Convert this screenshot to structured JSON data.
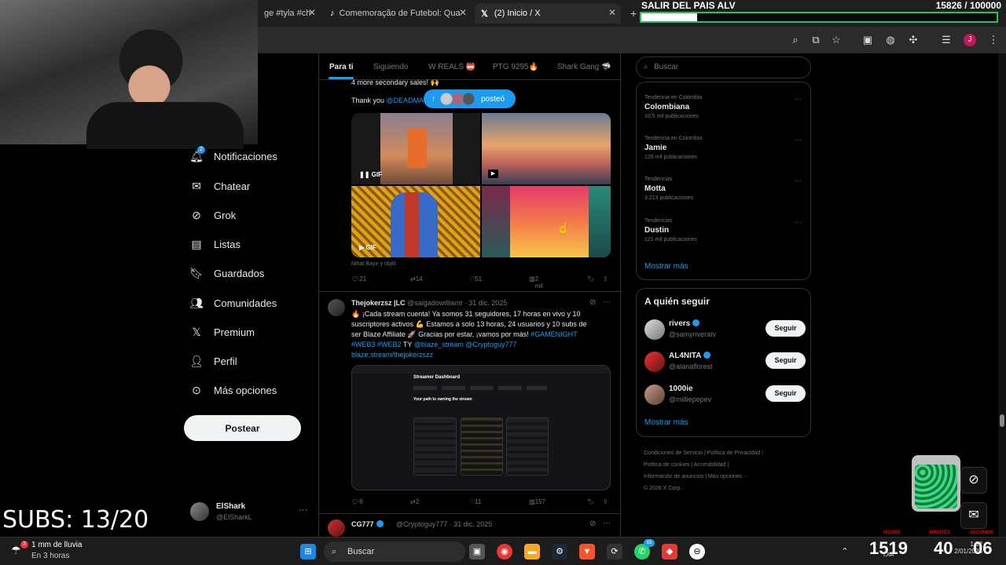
{
  "browser": {
    "tabs": [
      {
        "label": "ge #tyla #ch"
      },
      {
        "label": "Comemoração de Futebol: Qua"
      },
      {
        "label": "(2) Inicio / X"
      }
    ],
    "new_tab": "+"
  },
  "goal": {
    "title": "SALIR DEL PAIS ALV",
    "count": "15826  / 100000",
    "progress": 0.158
  },
  "nav": {
    "items": [
      {
        "label": "Notificaciones",
        "icon": "bell-icon"
      },
      {
        "label": "Chatear",
        "icon": "mail-icon"
      },
      {
        "label": "Grok",
        "icon": "grok-icon"
      },
      {
        "label": "Listas",
        "icon": "list-icon"
      },
      {
        "label": "Guardados",
        "icon": "bookmark-icon"
      },
      {
        "label": "Comunidades",
        "icon": "people-icon"
      },
      {
        "label": "Premium",
        "icon": "x-logo-icon"
      },
      {
        "label": "Perfil",
        "icon": "person-icon"
      },
      {
        "label": "Más opciones",
        "icon": "more-circle-icon"
      }
    ],
    "notif_badge": "2",
    "post_button": "Postear",
    "profile": {
      "name": "ElShark",
      "handle": "@ElSharkL",
      "more": "···"
    }
  },
  "subs_overlay": "SUBS: 13/20",
  "timeline": {
    "tabs": [
      "Para ti",
      "Siguiendo",
      "W REALS 📛",
      "PTG 9295🔥",
      "Shark Gang 🦈"
    ],
    "posted_pill": "posteó",
    "post1": {
      "text_top": "4 more secondary sales! 🙌",
      "thank_prefix": "Thank you ",
      "thank_handle": "@DEADMA",
      "gif_label": "GIF",
      "tagged": "Nihat Bayır y objkt",
      "stats": {
        "replies": "21",
        "reposts": "14",
        "likes": "51",
        "views": "2 mil"
      }
    },
    "post2": {
      "name": "Thejokerzsz |LC",
      "handle": "@salgadowilliamt",
      "date": "· 31 dic. 2025",
      "text_line1": "🔥 ¡Cada stream cuenta! Ya somos 31 seguidores, 17 horas en vivo y 10",
      "text_line2": "suscriptores activos 💪 Estamos a solo 13 horas, 24 usuarios y 10 subs de",
      "text_line3": "ser Blaze Affiliate 🚀 Gracias por estar, ¡vamos por más! ",
      "hashtag_gamenight": "#GAMENIGHT",
      "hashtags": "#WEB3 #WEB2",
      "ty": " TY ",
      "mentions": "@blaze_stream @Cryptoguy777",
      "link": "blaze.stream/thejokerzszz",
      "dashboard_title": "Streamer Dashboard",
      "dashboard_sub": "Your path to owning the stream",
      "stats": {
        "replies": "6",
        "reposts": "2",
        "likes": "11",
        "views": "157"
      }
    },
    "post3": {
      "name": "CG777",
      "handle": "@Cryptoguy777",
      "date": "· 31 dic. 2025"
    }
  },
  "right": {
    "search_placeholder": "Buscar",
    "trends": [
      {
        "context": "Tendencia en Colombia",
        "name": "Colombiana",
        "count": "10,5 mil publicaciones"
      },
      {
        "context": "Tendencia en Colombia",
        "name": "Jamie",
        "count": "126 mil publicaciones"
      },
      {
        "context": "Tendencias",
        "name": "Motta",
        "count": "3.213 publicaciones"
      },
      {
        "context": "Tendencias",
        "name": "Dustin",
        "count": "121 mil publicaciones"
      }
    ],
    "show_more": "Mostrar más",
    "who_to_follow_title": "A quién seguir",
    "follows": [
      {
        "name": "rivers",
        "handle": "@samyriveratv",
        "button": "Seguir"
      },
      {
        "name": "AL4NITA",
        "handle": "@alanaflorest",
        "button": "Seguir"
      },
      {
        "name": "1000ie",
        "handle": "@milliepepev",
        "button": "Seguir"
      }
    ],
    "footer_line1": "Condiciones de Servicio  |  Política de Privacidad  |",
    "footer_line2": "Política de cookies  |  Accesibilidad  |",
    "footer_line3": "Información de anuncios  |  Más opciones ···",
    "footer_line4": "© 2026 X Corp."
  },
  "taskbar": {
    "weather_title": "1 mm de lluvia",
    "weather_sub": "En 3 horas",
    "weather_badge": "3",
    "search": "Buscar",
    "timer": {
      "hours": "1519",
      "minutes": "40",
      "seconds": "06",
      "hours_label": "HOURS",
      "minutes_label": "MINUTES",
      "seconds_label": "SECONDS"
    },
    "clock_time": "1:52",
    "clock_date": "2/01/2026",
    "lang": "LAA",
    "whatsapp_badge": "83"
  },
  "colors": {
    "accent": "#1d9bf0",
    "background": "#000000",
    "goal_border": "#22c55e"
  }
}
